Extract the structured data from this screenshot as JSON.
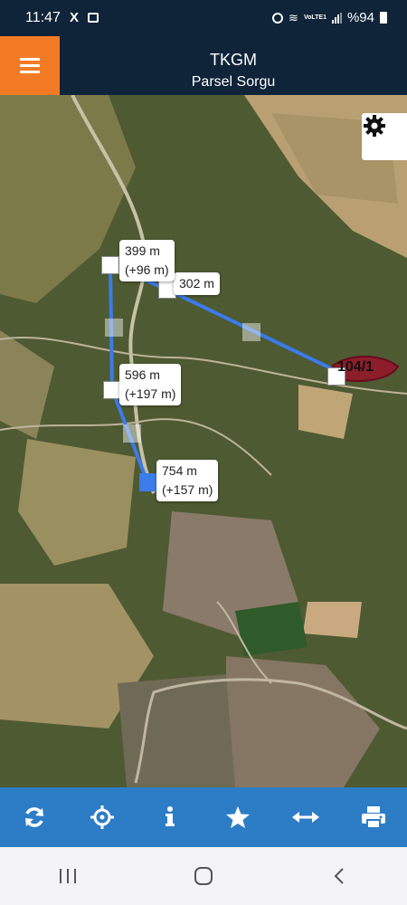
{
  "status_bar": {
    "time": "11:47",
    "x_icon": "X",
    "lte": "VoLTE1",
    "battery_text": "%94",
    "icons": [
      "x-icon",
      "image-icon",
      "alarm-icon",
      "wifi-icon",
      "signal-icon",
      "battery-icon"
    ]
  },
  "header": {
    "title": "TKGM",
    "subtitle": "Parsel Sorgu",
    "menu_icon": "hamburger-menu-icon",
    "accent_color": "#f47b25",
    "background_color": "#0f2339"
  },
  "map": {
    "settings_icon": "gear-icon",
    "parcel_label": "104/1",
    "measure_line_color": "#3b7bea",
    "measurements": [
      {
        "distance": "302 m"
      },
      {
        "distance": "399 m",
        "delta": "(+96 m)"
      },
      {
        "distance": "596 m",
        "delta": "(+197 m)"
      },
      {
        "distance": "754 m",
        "delta": "(+157 m)"
      }
    ]
  },
  "toolbar": {
    "background_color": "#2c7dc6",
    "buttons": [
      "refresh-icon",
      "crosshair-locate-icon",
      "info-icon",
      "star-favorite-icon",
      "measure-arrows-icon",
      "print-icon"
    ]
  },
  "nav_bar": {
    "buttons": [
      "recent-apps-icon",
      "home-icon",
      "back-icon"
    ]
  }
}
